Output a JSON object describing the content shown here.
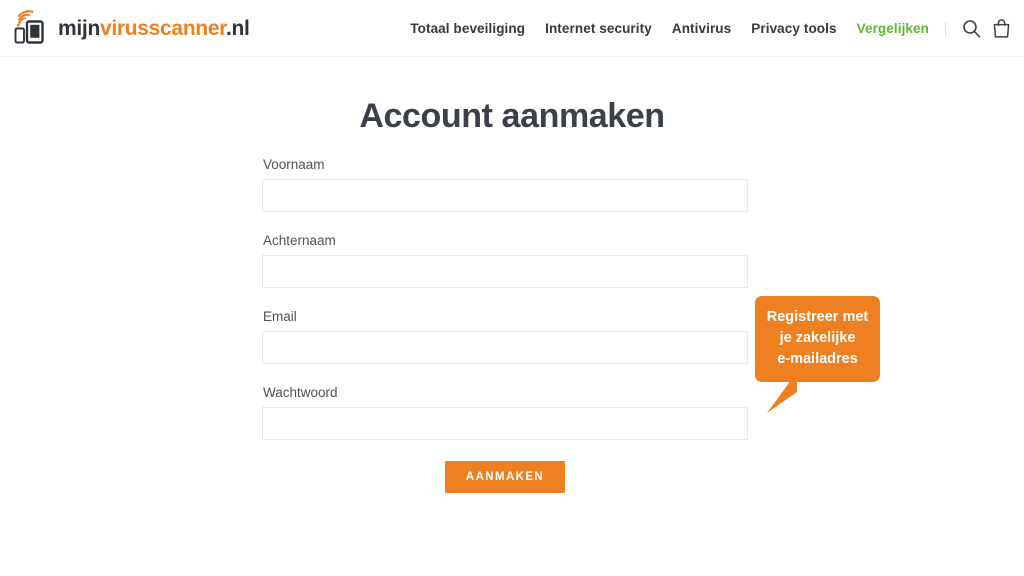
{
  "header": {
    "logo": {
      "icon": "tablet-wifi-icon",
      "text_dark_1": "mijn",
      "text_accent": "virusscanner",
      "text_dark_2": ".nl"
    },
    "nav": [
      {
        "label": "Totaal beveiliging",
        "accent": false
      },
      {
        "label": "Internet security",
        "accent": false
      },
      {
        "label": "Antivirus",
        "accent": false
      },
      {
        "label": "Privacy tools",
        "accent": false
      },
      {
        "label": "Vergelijken",
        "accent": true
      }
    ],
    "icons": [
      {
        "name": "search-icon"
      },
      {
        "name": "shopping-bag-icon"
      }
    ]
  },
  "main": {
    "title": "Account aanmaken",
    "form": {
      "fields": [
        {
          "label": "Voornaam",
          "value": "",
          "placeholder": "",
          "type": "text"
        },
        {
          "label": "Achternaam",
          "value": "",
          "placeholder": "",
          "type": "text"
        },
        {
          "label": "Email",
          "value": "",
          "placeholder": "",
          "type": "email"
        },
        {
          "label": "Wachtwoord",
          "value": "",
          "placeholder": "",
          "type": "password"
        }
      ],
      "submit_label": "AANMAKEN"
    },
    "tooltip": {
      "text": "Registreer met\nje zakelijke\ne-mailadres"
    }
  },
  "colors": {
    "brand_orange": "#ef8022",
    "accent_green": "#5eb734",
    "text_dark": "#3a4148",
    "text_label": "#4d5358",
    "border_light": "#e6e7e8",
    "header_border": "#f0f0f0",
    "page_background": "#ffffff"
  }
}
